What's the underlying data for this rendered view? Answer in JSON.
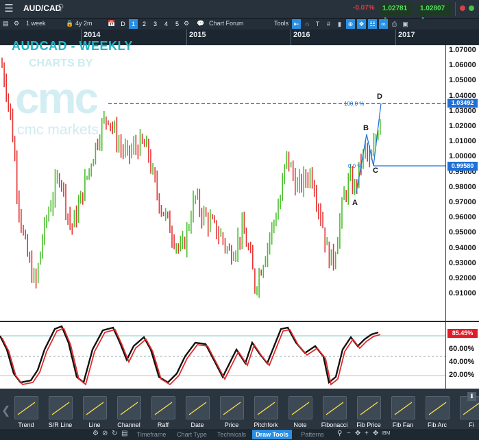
{
  "titlebar": {
    "symbol": "AUD/CAD",
    "change": "-0.07%",
    "bid": "1.02781",
    "ask": "1.02807"
  },
  "toolbar": {
    "interval": "1 week",
    "range": "4y 2m",
    "periods": [
      "D",
      "1",
      "2",
      "3",
      "4",
      "5"
    ],
    "active_period": "1",
    "chart_forum": "Chart Forum",
    "tools_label": "Tools"
  },
  "chart": {
    "title": "AUDCAD - WEEKLY",
    "watermark_by": "CHARTS BY",
    "watermark_logo": "cmc",
    "watermark_sub": "cmc markets",
    "years": [
      "2014",
      "2015",
      "2016",
      "2017"
    ],
    "price_labels": [
      "1.07000",
      "1.06000",
      "1.05000",
      "1.04000",
      "1.03000",
      "1.02000",
      "1.01000",
      "1.00000",
      "0.99000",
      "0.98000",
      "0.97000",
      "0.96000",
      "0.95000",
      "0.94000",
      "0.93000",
      "0.92000",
      "0.91000"
    ],
    "tag_high": "1.03492",
    "tag_low": "0.99580",
    "fib_high_label": "100.0 %",
    "fib_low_label": "0.0 %",
    "points": [
      "A",
      "B",
      "C",
      "D"
    ],
    "colors": {
      "up": "#4bbf2e",
      "down": "#e53535",
      "fib": "#1f6fd6"
    }
  },
  "oscillator": {
    "value_tag": "85.45%",
    "levels": [
      "60.00%",
      "40.00%",
      "20.00%"
    ]
  },
  "tools": [
    {
      "label": "Trend"
    },
    {
      "label": "S/R Line"
    },
    {
      "label": "Line"
    },
    {
      "label": "Channel"
    },
    {
      "label": "Raff"
    },
    {
      "label": "Date"
    },
    {
      "label": "Price"
    },
    {
      "label": "Pitchfork"
    },
    {
      "label": "Note"
    },
    {
      "label": "Fibonacci"
    },
    {
      "label": "Fib Price"
    },
    {
      "label": "Fib Fan"
    },
    {
      "label": "Fib Arc"
    },
    {
      "label": "Fi"
    }
  ],
  "tabs": [
    "Timeframe",
    "Chart Type",
    "Technicals",
    "Draw Tools",
    "Patterns"
  ],
  "active_tab": "Draw Tools"
}
